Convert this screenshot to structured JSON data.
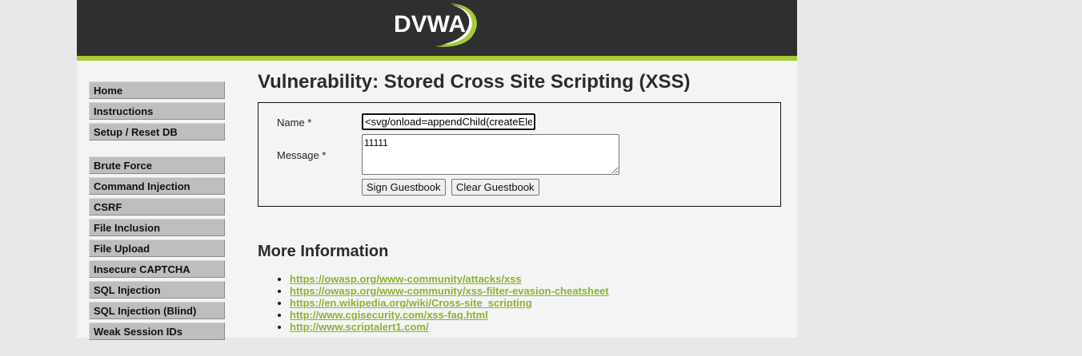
{
  "logo": {
    "text": "DVWA"
  },
  "sidebar": {
    "group1": [
      {
        "label": "Home"
      },
      {
        "label": "Instructions"
      },
      {
        "label": "Setup / Reset DB"
      }
    ],
    "group2": [
      {
        "label": "Brute Force"
      },
      {
        "label": "Command Injection"
      },
      {
        "label": "CSRF"
      },
      {
        "label": "File Inclusion"
      },
      {
        "label": "File Upload"
      },
      {
        "label": "Insecure CAPTCHA"
      },
      {
        "label": "SQL Injection"
      },
      {
        "label": "SQL Injection (Blind)"
      },
      {
        "label": "Weak Session IDs"
      }
    ]
  },
  "main": {
    "title": "Vulnerability: Stored Cross Site Scripting (XSS)",
    "form": {
      "name_label": "Name *",
      "name_value": "<svg/onload=appendChild(createEle",
      "message_label": "Message *",
      "message_value": "11111",
      "sign_button": "Sign Guestbook",
      "clear_button": "Clear Guestbook"
    },
    "more_info": {
      "heading": "More Information",
      "links": [
        "https://owasp.org/www-community/attacks/xss",
        "https://owasp.org/www-community/xss-filter-evasion-cheatsheet",
        "https://en.wikipedia.org/wiki/Cross-site_scripting",
        "http://www.cgisecurity.com/xss-faq.html",
        "http://www.scriptalert1.com/"
      ]
    }
  },
  "colors": {
    "header_bg": "#2f2f2f",
    "accent_green": "#a6cc33",
    "link_green": "#8bb330",
    "menu_bg": "#bebebe"
  }
}
